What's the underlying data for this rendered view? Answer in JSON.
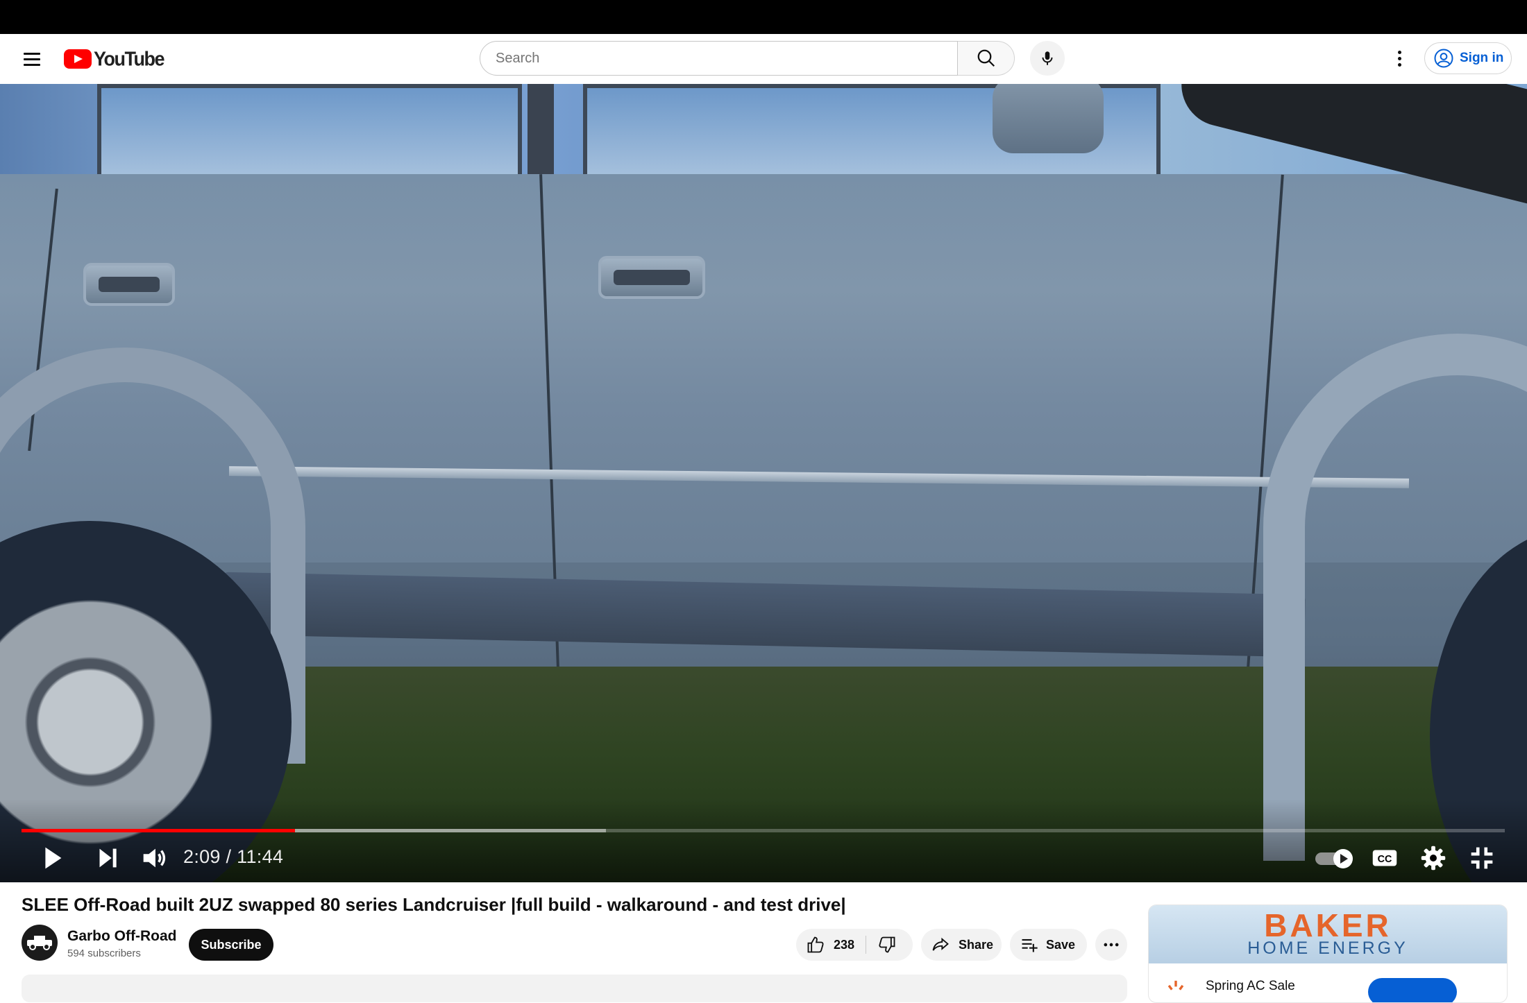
{
  "header": {
    "logo_text": "YouTube",
    "search_placeholder": "Search",
    "sign_in_label": "Sign in"
  },
  "player": {
    "time_display": "2:09 / 11:44",
    "current_time": "2:09",
    "duration": "11:44",
    "played_fraction": 0.1846,
    "loaded_fraction": 0.394,
    "autoplay_on": true,
    "progress_color": "#ff0000"
  },
  "video": {
    "title": "SLEE Off-Road built 2UZ swapped 80 series Landcruiser |full build - walkaround - and test drive|",
    "channel_name": "Garbo Off-Road",
    "subscribers": "594 subscribers",
    "subscribe_label": "Subscribe",
    "like_count": "238",
    "share_label": "Share",
    "save_label": "Save"
  },
  "ad": {
    "brand": "BAKER",
    "brand_sub": "HOME ENERGY",
    "headline": "Spring AC Sale",
    "brand_color": "#e5652b"
  }
}
